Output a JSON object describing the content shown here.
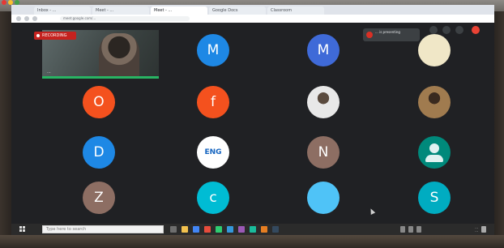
{
  "browser": {
    "tabs": [
      {
        "title": "Inbox - ...",
        "active": false
      },
      {
        "title": "Meet - ...",
        "active": false
      },
      {
        "title": "Meet - ...",
        "active": true
      },
      {
        "title": "Google Docs",
        "active": false
      },
      {
        "title": "Classroom",
        "active": false
      }
    ],
    "url": "meet.google.com/..."
  },
  "meeting": {
    "recording_label": "RECORDING",
    "self_video_name": "...",
    "toast_text": "... is presenting",
    "participants": [
      {
        "initial": "M",
        "color": "#1e88e5"
      },
      {
        "initial": "M",
        "color": "#3f6ad8"
      },
      {
        "initial": "",
        "color": "#f0e7c7",
        "kind": "photo-pale"
      },
      {
        "initial": "O",
        "color": "#f4511e"
      },
      {
        "initial": "f",
        "color": "#f4511e"
      },
      {
        "initial": "",
        "color": "#e8e8e8",
        "kind": "photo-person"
      },
      {
        "initial": "",
        "color": "#a07b4f",
        "kind": "photo-dark"
      },
      {
        "initial": "D",
        "color": "#1e88e5"
      },
      {
        "initial": "ENG",
        "color": "#ffffff",
        "kind": "logo"
      },
      {
        "initial": "N",
        "color": "#8d6e63"
      },
      {
        "initial": "",
        "color": "#00897b",
        "kind": "avatar-default"
      },
      {
        "initial": "Z",
        "color": "#8d6e63"
      },
      {
        "initial": "c",
        "color": "#00bcd4"
      },
      {
        "initial": "",
        "color": "#4fc3f7",
        "kind": "blank"
      },
      {
        "initial": "S",
        "color": "#00acc1"
      }
    ]
  },
  "taskbar": {
    "search_placeholder": "Type here to search",
    "time": "...",
    "date": "..."
  }
}
